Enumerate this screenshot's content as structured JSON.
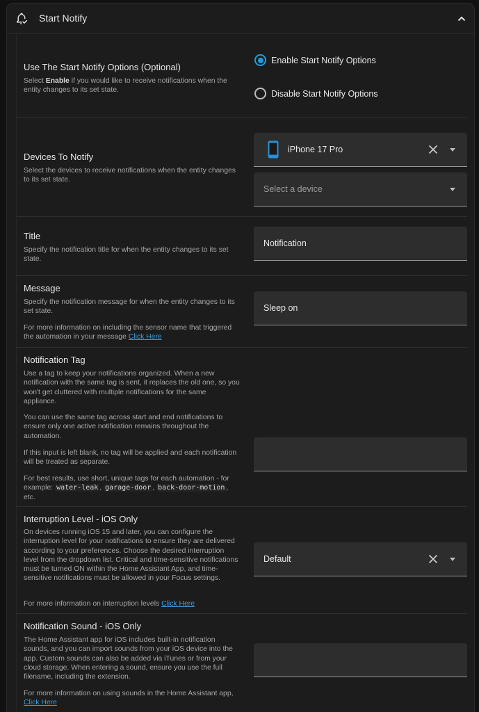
{
  "header": {
    "title": "Start Notify"
  },
  "start_notify": {
    "label": "Use The Start Notify Options (Optional)",
    "desc_pre": "Select ",
    "desc_bold": "Enable",
    "desc_post": " if you would like to receive notifications when the entity changes to its set state.",
    "options": [
      "Enable Start Notify Options",
      "Disable Start Notify Options"
    ],
    "selected": "Enable Start Notify Options"
  },
  "devices": {
    "label": "Devices To Notify",
    "desc": "Select the devices to receive notifications when the entity changes to its set state.",
    "selected_device": "iPhone 17 Pro",
    "placeholder": "Select a device"
  },
  "title_field": {
    "label": "Title",
    "desc": "Specify the notification title for when the entity changes to its set state.",
    "value": "Notification"
  },
  "message": {
    "label": "Message",
    "desc": "Specify the notification message for when the entity changes to its set state.",
    "desc2": "For more information on including the sensor name that triggered the automation in your message ",
    "link": "Click Here",
    "value": "Sleep on"
  },
  "tag": {
    "label": "Notification Tag",
    "desc1": "Use a tag to keep your notifications organized. When a new notification with the same tag is sent, it replaces the old one, so you won't get cluttered with multiple notifications for the same appliance.",
    "desc2": "You can use the same tag across start and end notifications to ensure only one active notification remains throughout the automation.",
    "desc3": "If this input is left blank, no tag will be applied and each notification will be treated as separate.",
    "desc4_pre": "For best results, use short, unique tags for each automation - for example: ",
    "code1": "water-leak",
    "code2": "garage-door",
    "code3": "back-door-motion",
    "desc4_post": ", etc.",
    "value": ""
  },
  "interruption": {
    "label": "Interruption Level - iOS Only",
    "desc1": "On devices running iOS 15 and later, you can configure the interruption level for your notifications to ensure they are delivered according to your preferences. Choose the desired interruption level from the dropdown list. Critical and time-sensitive notifications must be turned ON within the Home Assistant App, and time-sensitive notifications must be allowed in your Focus settings.",
    "desc2": "For more information on interruption levels ",
    "link": "Click Here",
    "value": "Default"
  },
  "sound": {
    "label": "Notification Sound - iOS Only",
    "desc1": "The Home Assistant app for iOS includes built-in notification sounds, and you can import sounds from your iOS device into the app. Custom sounds can also be added via iTunes or from your cloud storage. When entering a sound, ensure you use the full filename, including the extension.",
    "desc2": "For more information on using sounds in the Home Assistant app, ",
    "link": "Click Here",
    "value": ""
  },
  "colors": {
    "accent": "#1e9ddc",
    "link": "#3b9de0",
    "background": "#1c1c1c",
    "field": "#2d2d2d"
  },
  "icons": [
    "bell-check-icon",
    "chevron-up-icon",
    "radio-checked-icon",
    "radio-unchecked-icon",
    "cellphone-icon",
    "close-icon",
    "menu-down-icon"
  ]
}
